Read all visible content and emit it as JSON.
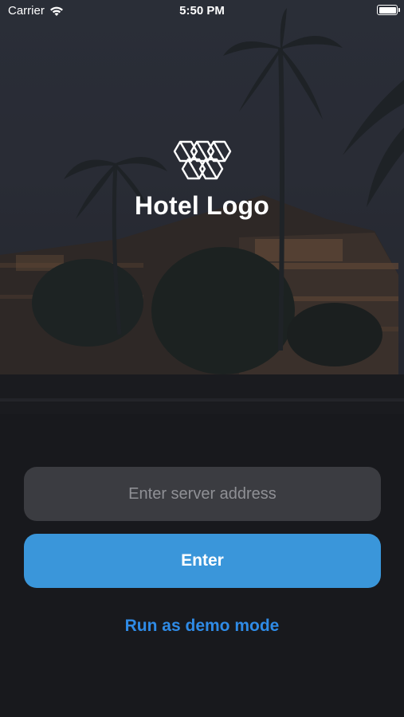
{
  "status_bar": {
    "carrier": "Carrier",
    "time": "5:50 PM",
    "wifi_icon": "wifi-icon",
    "battery_icon": "battery-icon",
    "battery_level": 1.0
  },
  "brand": {
    "logo_icon": "hexagon-lattice-logo-icon",
    "name": "Hotel Logo"
  },
  "login": {
    "server_field": {
      "placeholder": "Enter server address",
      "value": ""
    },
    "enter_label": "Enter",
    "demo_label": "Run as demo mode"
  },
  "colors": {
    "accent": "#3a96da",
    "link": "#2f8be6",
    "input_bg": "#3b3c41",
    "background": "#17181d"
  },
  "background_image": "hotel-with-palm-trees-at-night"
}
